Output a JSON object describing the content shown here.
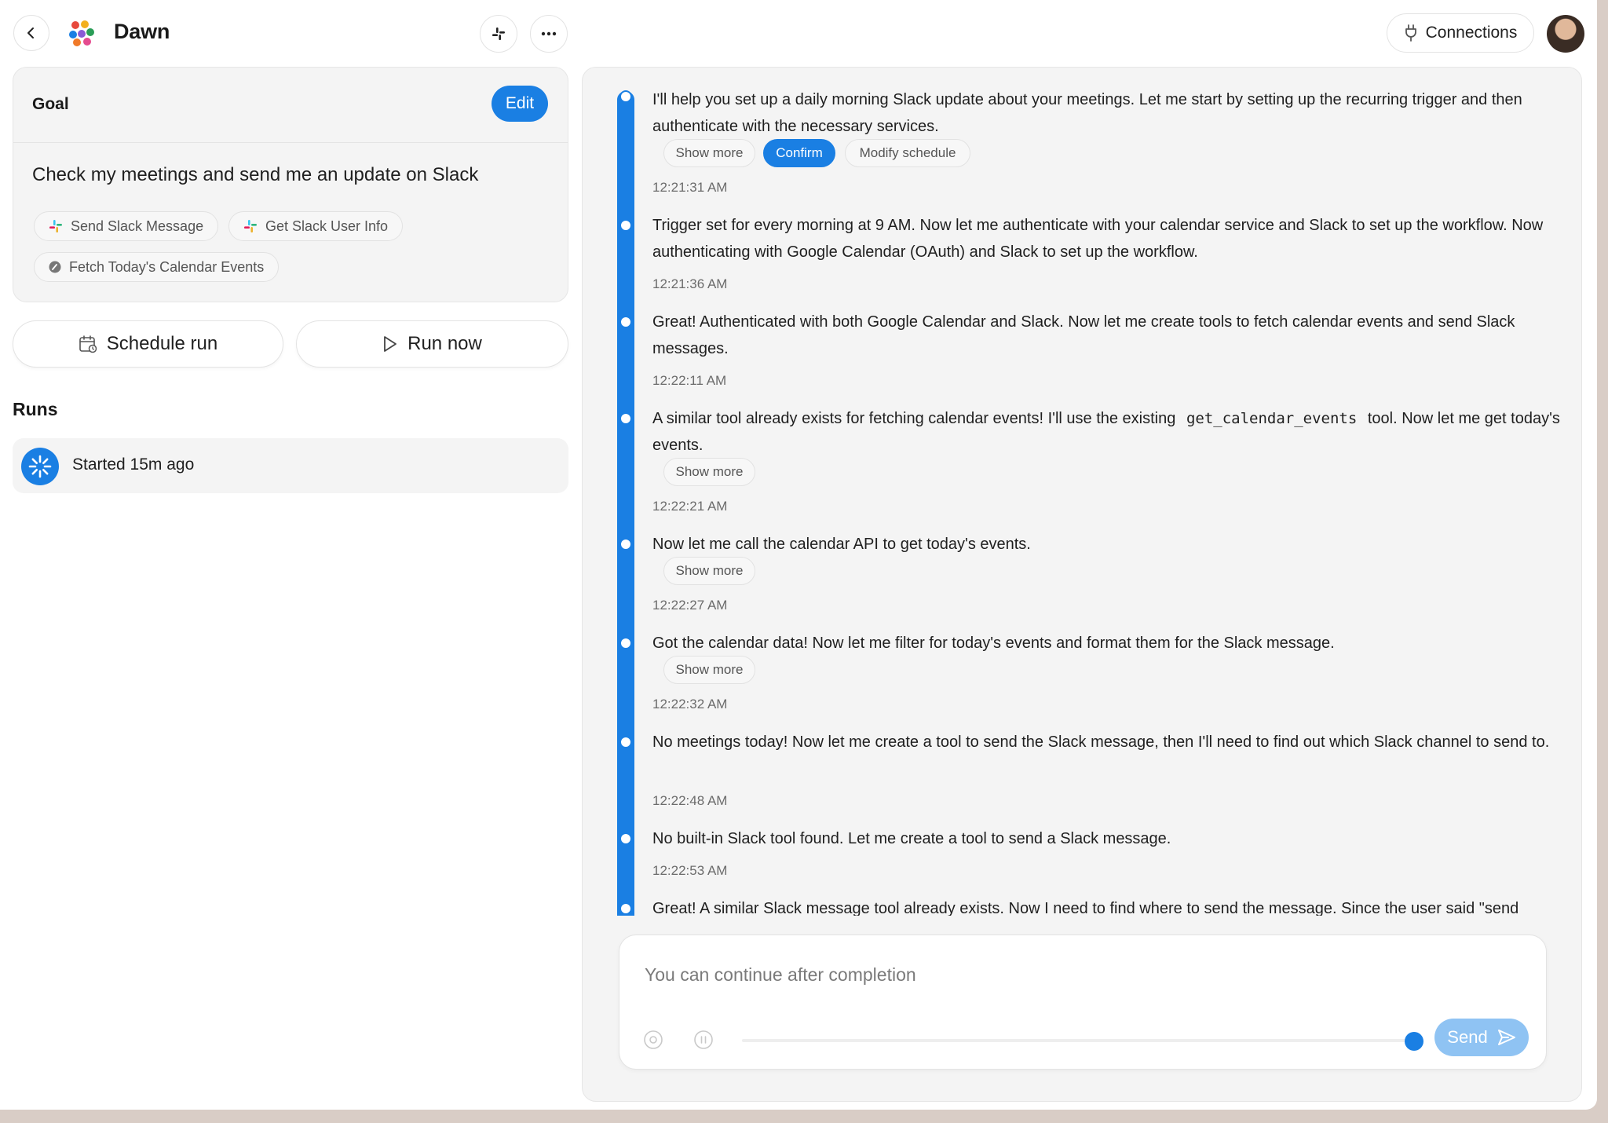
{
  "header": {
    "title": "Dawn",
    "connections_label": "Connections"
  },
  "goal": {
    "label": "Goal",
    "edit_label": "Edit",
    "text": "Check my meetings and send me an update on Slack",
    "tools": [
      {
        "label": "Send Slack Message",
        "icon": "slack-icon"
      },
      {
        "label": "Get Slack User Info",
        "icon": "slack-icon"
      },
      {
        "label": "Fetch Today's Calendar Events",
        "icon": "tool-icon"
      }
    ]
  },
  "actions": {
    "schedule_label": "Schedule run",
    "run_label": "Run now"
  },
  "runs": {
    "title": "Runs",
    "items": [
      {
        "status": "Started 15m ago"
      }
    ]
  },
  "log": {
    "entries": [
      {
        "text": "I'll help you set up a daily morning Slack update about your meetings. Let me start by setting up the recurring trigger and then authenticate with the necessary services.",
        "time": "12:21:31 AM"
      },
      {
        "text": "Trigger set for every morning at 9 AM. Now let me authenticate with your calendar service and Slack to set up the workflow. Now authenticating with Google Calendar (OAuth) and Slack to set up the workflow.",
        "time": "12:21:36 AM"
      },
      {
        "text": "Great! Authenticated with both Google Calendar and Slack. Now let me create tools to fetch calendar events and send Slack messages.",
        "time": "12:22:11 AM"
      },
      {
        "text_before": "A similar tool already exists for fetching calendar events! I'll use the existing",
        "code": "get_calendar_events",
        "text_after": "tool. Now let me get today's events.",
        "time": "12:22:21 AM"
      },
      {
        "text": "Now let me call the calendar API to get today's events.",
        "time": "12:22:27 AM"
      },
      {
        "text": "Got the calendar data! Now let me filter for today's events and format them for the Slack message.",
        "time": "12:22:32 AM"
      },
      {
        "text": "No meetings today! Now let me create a tool to send the Slack message, then I'll need to find out which Slack channel to send to.",
        "time": "12:22:48 AM"
      },
      {
        "text": "No built-in Slack tool found. Let me create a tool to send a Slack message.",
        "time": "12:22:53 AM"
      },
      {
        "text": "Great! A similar Slack message tool already exists. Now I need to find where to send the message. Since the user said \"send"
      }
    ],
    "show_more_label": "Show more",
    "confirm_label": "Confirm",
    "modify_label": "Modify schedule"
  },
  "composer": {
    "placeholder": "You can continue after completion",
    "send_label": "Send"
  },
  "colors": {
    "accent": "#1a7fe3",
    "send_disabled": "#8fc3f3",
    "panel_bg": "#f4f4f4"
  }
}
